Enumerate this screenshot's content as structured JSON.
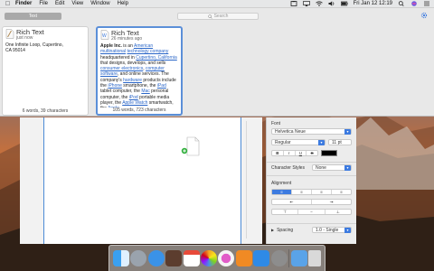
{
  "menubar": {
    "app_name": "Finder",
    "items": [
      "File",
      "Edit",
      "View",
      "Window",
      "Help"
    ],
    "clock": "Fri Jan 12  12:19"
  },
  "panel": {
    "tab_label": "Text",
    "search_placeholder": "Search",
    "cards": [
      {
        "title": "Rich Text",
        "time": "just now",
        "body_lines": [
          "One Infinite Loop, Cupertino,",
          "CA 95014"
        ],
        "footer": "6 words, 39 characters"
      },
      {
        "title": "Rich Text",
        "time": "26 minutes ago",
        "body_segments": [
          {
            "t": "Apple Inc.",
            "b": true
          },
          {
            "t": " is an "
          },
          {
            "t": "American",
            "l": true
          },
          {
            "t": " "
          },
          {
            "t": "multinational",
            "l": true
          },
          {
            "t": " "
          },
          {
            "t": "technology company",
            "l": true
          },
          {
            "t": " headquartered in "
          },
          {
            "t": "Cupertino, California",
            "l": true
          },
          {
            "t": " that designs, develops, and sells "
          },
          {
            "t": "consumer electronics",
            "l": true
          },
          {
            "t": ", "
          },
          {
            "t": "computer software",
            "l": true
          },
          {
            "t": ", and online services. The company's "
          },
          {
            "t": "hardware",
            "l": true
          },
          {
            "t": " products include the "
          },
          {
            "t": "iPhone",
            "l": true
          },
          {
            "t": " smartphone, the "
          },
          {
            "t": "iPad",
            "l": true
          },
          {
            "t": " tablet computer, the "
          },
          {
            "t": "Mac",
            "l": true
          },
          {
            "t": " personal computer, the "
          },
          {
            "t": "iPod",
            "l": true
          },
          {
            "t": " portable media player, the "
          },
          {
            "t": "Apple Watch",
            "l": true
          },
          {
            "t": " smartwatch, the "
          },
          {
            "t": "Apple",
            "l": true
          }
        ],
        "footer": "105 words, 723 characters"
      }
    ]
  },
  "inspector": {
    "font_section": "Font",
    "font_family": "Helvetica Neue",
    "font_style": "Regular",
    "font_size": "11 pt",
    "style_buttons": [
      "B",
      "I",
      "U",
      "S"
    ],
    "character_styles_label": "Character Styles",
    "character_styles_value": "None",
    "alignment_section": "Alignment",
    "spacing_label": "Spacing",
    "spacing_value": "1.0 - Single"
  },
  "colors": {
    "accent": "#3d7be0",
    "link": "#2a66c8",
    "selected_card_border": "#5b8fd8"
  },
  "dock": {
    "apps": [
      {
        "name": "Finder",
        "icon": "finder-icon",
        "color": "#2f8ae6"
      },
      {
        "name": "Launchpad",
        "icon": "launchpad-icon",
        "color": "#9aa3ad"
      },
      {
        "name": "Safari",
        "icon": "safari-icon",
        "color": "#3a92e8"
      },
      {
        "name": "Photo Booth",
        "icon": "photo-booth-icon",
        "color": "#5c3d2e"
      },
      {
        "name": "Calendar",
        "icon": "calendar-icon",
        "color": "#ffffff"
      },
      {
        "name": "Photos",
        "icon": "photos-icon",
        "color": "#f3f3f3"
      },
      {
        "name": "iTunes",
        "icon": "itunes-icon",
        "color": "#f2f2f2"
      },
      {
        "name": "iBooks",
        "icon": "ibooks-icon",
        "color": "#f08a24"
      },
      {
        "name": "App Store",
        "icon": "app-store-icon",
        "color": "#2f8ae6"
      },
      {
        "name": "System Preferences",
        "icon": "system-preferences-icon",
        "color": "#8d8d8d"
      },
      {
        "name": "Downloads",
        "icon": "downloads-folder-icon",
        "color": "#5aa3e8"
      },
      {
        "name": "Trash",
        "icon": "trash-icon",
        "color": "#d9d9d9"
      }
    ]
  }
}
